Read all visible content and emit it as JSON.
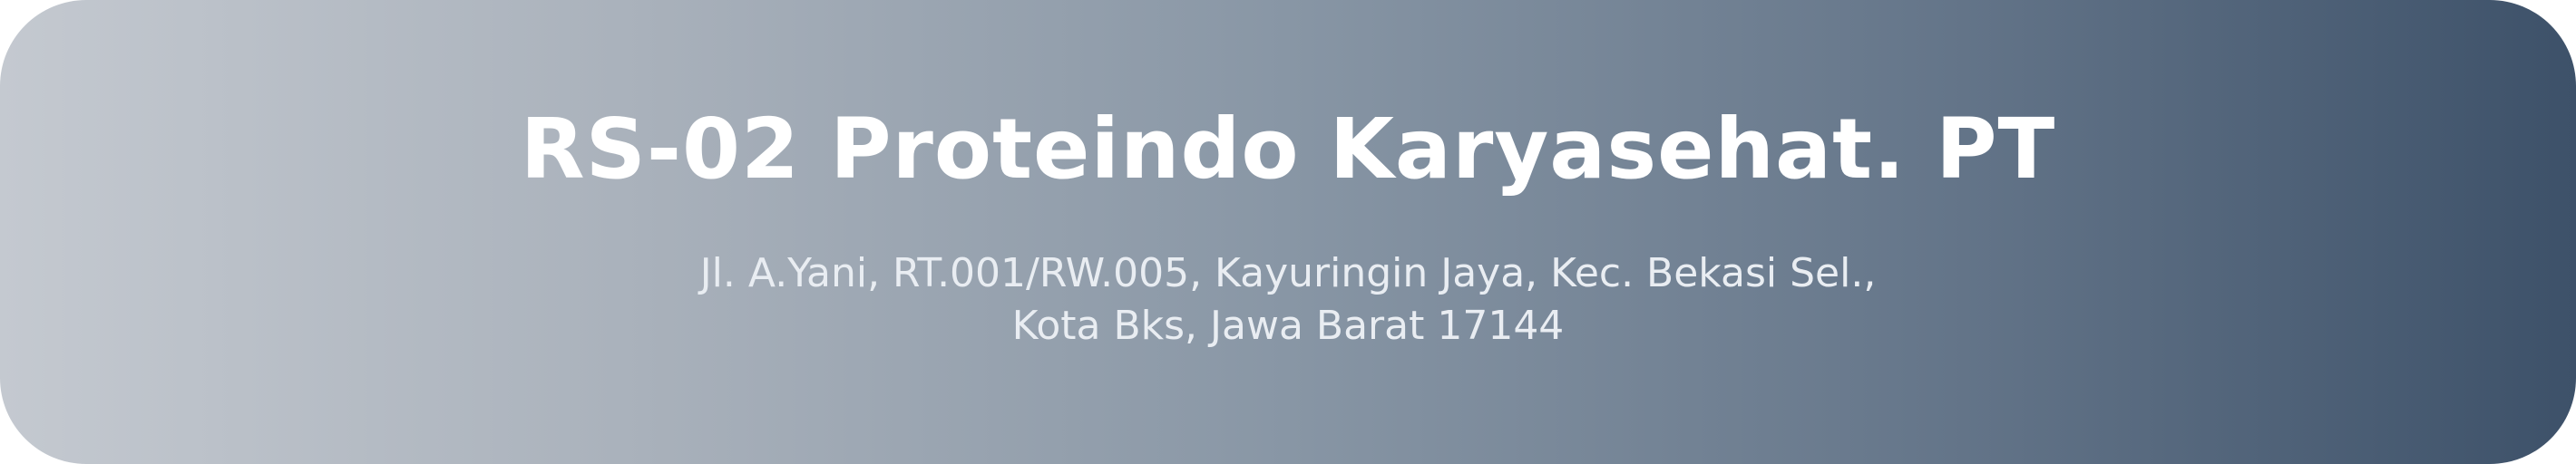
{
  "card": {
    "title": "RS-02 Proteindo Karyasehat. PT",
    "address": "Jl. A.Yani, RT.001/RW.005, Kayuringin Jaya, Kec. Bekasi Sel., Kota Bks, Jawa Barat 17144"
  },
  "colors": {
    "gradient_start": "#c4c9d0",
    "gradient_end": "#3d5169",
    "title_text": "#ffffff",
    "address_text": "#e9edf2"
  }
}
